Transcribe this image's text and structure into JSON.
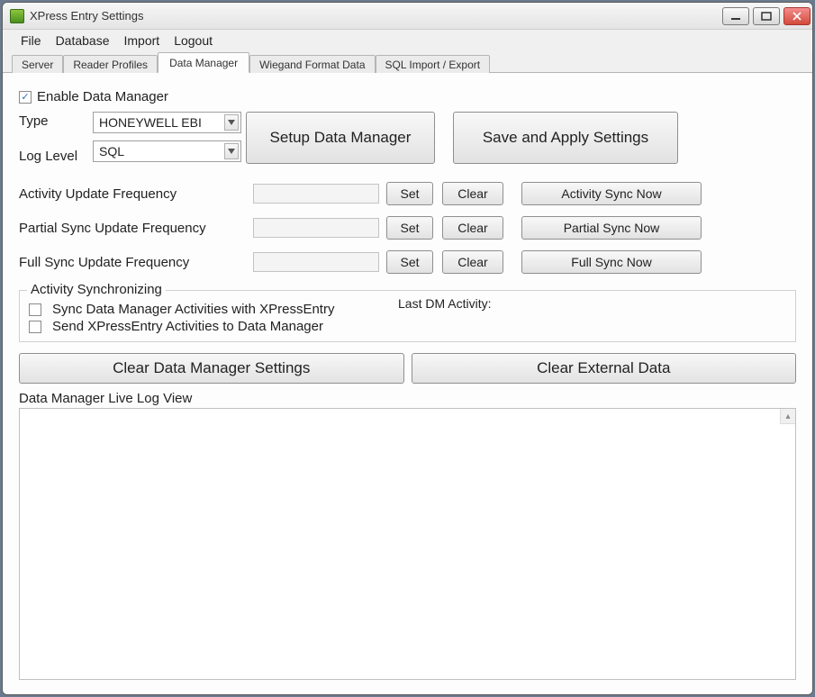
{
  "window": {
    "title": "XPress Entry Settings"
  },
  "menu": {
    "file": "File",
    "database": "Database",
    "import": "Import",
    "logout": "Logout"
  },
  "tabs": {
    "server": "Server",
    "reader_profiles": "Reader Profiles",
    "data_manager": "Data Manager",
    "wiegand": "Wiegand Format Data",
    "sql": "SQL Import / Export"
  },
  "dm": {
    "enable": "Enable Data Manager",
    "type_label": "Type",
    "type_value": "HONEYWELL EBI",
    "loglevel_label": "Log Level",
    "loglevel_value": "SQL",
    "setup_btn": "Setup Data Manager",
    "save_btn": "Save and Apply Settings",
    "freq": {
      "activity": "Activity Update Frequency",
      "partial": "Partial Sync Update Frequency",
      "full": "Full Sync Update Frequency",
      "set": "Set",
      "clear": "Clear",
      "activity_now": "Activity Sync Now",
      "partial_now": "Partial Sync Now",
      "full_now": "Full Sync Now"
    },
    "sync_group": {
      "title": "Activity Synchronizing",
      "opt1": "Sync Data Manager Activities with XPressEntry",
      "opt2": "Send XPressEntry Activities to Data Manager",
      "last": "Last DM Activity:"
    },
    "clear_settings": "Clear Data Manager Settings",
    "clear_external": "Clear External Data",
    "log_label": "Data Manager Live Log View"
  }
}
